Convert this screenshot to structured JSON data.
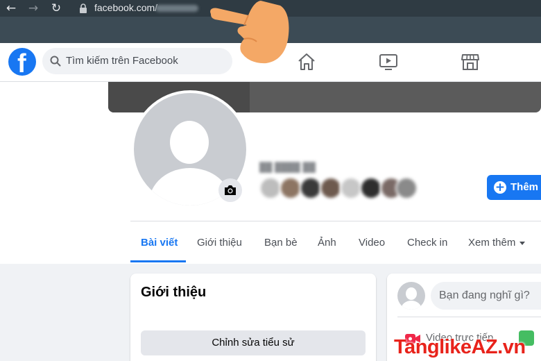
{
  "browser": {
    "back_icon": "arrow-left-icon",
    "forward_icon": "arrow-right-icon",
    "reload_icon": "reload-icon",
    "lock_icon": "lock-icon",
    "url": "facebook.com/"
  },
  "header": {
    "logo_letter": "f",
    "search_placeholder": "Tìm kiếm trên Facebook",
    "nav_icons": [
      "home-icon",
      "watch-icon",
      "marketplace-icon"
    ],
    "brand_color": "#1877f2"
  },
  "profile": {
    "add_friend_label": "Thêm v"
  },
  "tabs": [
    {
      "label": "Bài viết",
      "active": true
    },
    {
      "label": "Giới thiệu"
    },
    {
      "label": "Bạn bè"
    },
    {
      "label": "Ảnh"
    },
    {
      "label": "Video"
    },
    {
      "label": "Check in"
    },
    {
      "label": "Xem thêm"
    }
  ],
  "intro": {
    "title": "Giới thiệu",
    "edit_bio_label": "Chỉnh sửa tiểu sử"
  },
  "composer": {
    "placeholder": "Bạn đang nghĩ gì?",
    "live_video_label": "Video trực tiếp"
  },
  "watermark": "TanglikeAZ.vn"
}
